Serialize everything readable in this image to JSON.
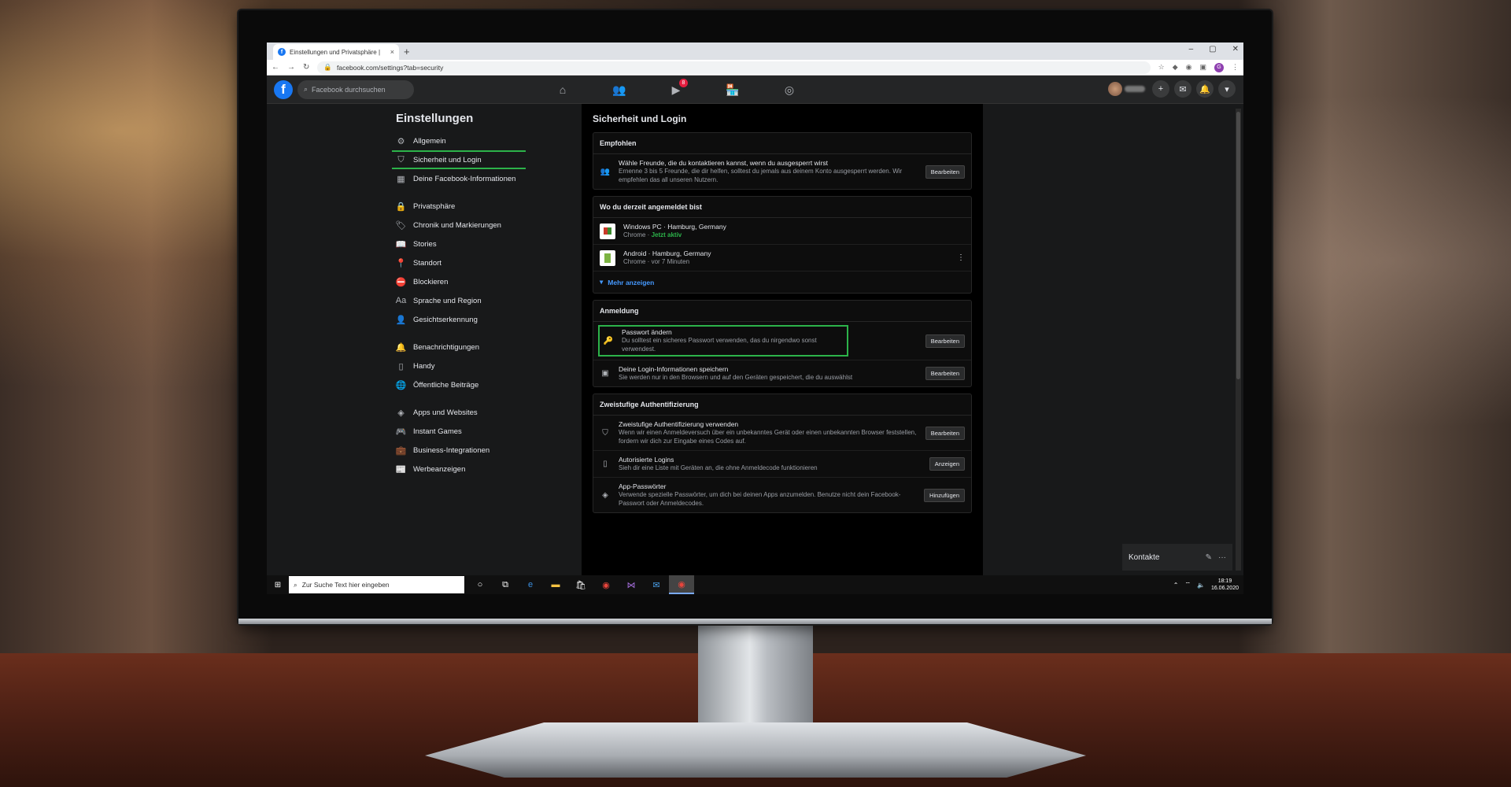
{
  "browser": {
    "tab_title": "Einstellungen und Privatsphäre |",
    "tab_close": "×",
    "new_tab": "+",
    "url": "facebook.com/settings?tab=security",
    "window_controls": [
      "–",
      "▢",
      "✕"
    ],
    "profile_initial": "G"
  },
  "fb": {
    "logo": "f",
    "search_placeholder": "Facebook durchsuchen",
    "watch_badge": "8",
    "nav_icons": [
      "home-icon",
      "friends-icon",
      "watch-icon",
      "marketplace-icon",
      "groups-icon"
    ]
  },
  "sidebar": {
    "title": "Einstellungen",
    "groups": [
      [
        {
          "icon": "⚙",
          "label": "Allgemein"
        },
        {
          "icon": "⛉",
          "label": "Sicherheit und Login",
          "active": true
        },
        {
          "icon": "▦",
          "label": "Deine Facebook-Informationen"
        }
      ],
      [
        {
          "icon": "🔒",
          "label": "Privatsphäre"
        },
        {
          "icon": "🏷",
          "label": "Chronik und Markierungen"
        },
        {
          "icon": "📖",
          "label": "Stories"
        },
        {
          "icon": "📍",
          "label": "Standort"
        },
        {
          "icon": "⛔",
          "label": "Blockieren"
        },
        {
          "icon": "Aa",
          "label": "Sprache und Region"
        },
        {
          "icon": "👤",
          "label": "Gesichtserkennung"
        }
      ],
      [
        {
          "icon": "🔔",
          "label": "Benachrichtigungen"
        },
        {
          "icon": "▯",
          "label": "Handy"
        },
        {
          "icon": "🌐",
          "label": "Öffentliche Beiträge"
        }
      ],
      [
        {
          "icon": "◈",
          "label": "Apps und Websites"
        },
        {
          "icon": "🎮",
          "label": "Instant Games"
        },
        {
          "icon": "💼",
          "label": "Business-Integrationen"
        },
        {
          "icon": "📰",
          "label": "Werbeanzeigen"
        }
      ]
    ]
  },
  "main": {
    "title": "Sicherheit und Login",
    "recommended": {
      "header": "Empfohlen",
      "t1": "Wähle Freunde, die du kontaktieren kannst, wenn du ausgesperrt wirst",
      "t2": "Ernenne 3 bis 5 Freunde, die dir helfen, solltest du jemals aus deinem Konto ausgesperrt werden. Wir empfehlen das all unseren Nutzern.",
      "button": "Bearbeiten"
    },
    "sessions": {
      "header": "Wo du derzeit angemeldet bist",
      "items": [
        {
          "device": "Windows PC · Hamburg, Germany",
          "browser": "Chrome · ",
          "status": "Jetzt aktiv"
        },
        {
          "device": "Android · Hamburg, Germany",
          "browser": "Chrome · vor 7 Minuten",
          "status": ""
        }
      ],
      "more": "Mehr anzeigen",
      "kebab": "⋮"
    },
    "login": {
      "header": "Anmeldung",
      "password_t1": "Passwort ändern",
      "password_t2": "Du solltest ein sicheres Passwort verwenden, das du nirgendwo sonst verwendest.",
      "password_btn": "Bearbeiten",
      "save_t1": "Deine Login-Informationen speichern",
      "save_t2": "Sie werden nur in den Browsern und auf den Geräten gespeichert, die du auswählst",
      "save_btn": "Bearbeiten"
    },
    "twofa": {
      "header": "Zweistufige Authentifizierung",
      "use_t1": "Zweistufige Authentifizierung verwenden",
      "use_t2": "Wenn wir einen Anmeldeversuch über ein unbekanntes Gerät oder einen unbekannten Browser feststellen, fordern wir dich zur Eingabe eines Codes auf.",
      "use_btn": "Bearbeiten",
      "auth_t1": "Autorisierte Logins",
      "auth_t2": "Sieh dir eine Liste mit Geräten an, die ohne Anmeldecode funktionieren",
      "auth_btn": "Anzeigen",
      "app_t1": "App-Passwörter",
      "app_t2": "Verwende spezielle Passwörter, um dich bei deinen Apps anzumelden. Benutze nicht dein Facebook-Passwort oder Anmeldecodes.",
      "app_btn": "Hinzufügen"
    }
  },
  "contacts": {
    "label": "Kontakte",
    "more": "···"
  },
  "taskbar": {
    "search_placeholder": "Zur Suche Text hier eingeben",
    "time": "18:19",
    "date": "16.06.2020"
  },
  "colors": {
    "highlight": "#2cb34a",
    "fb_blue": "#1877f2",
    "link": "#4599ff"
  }
}
